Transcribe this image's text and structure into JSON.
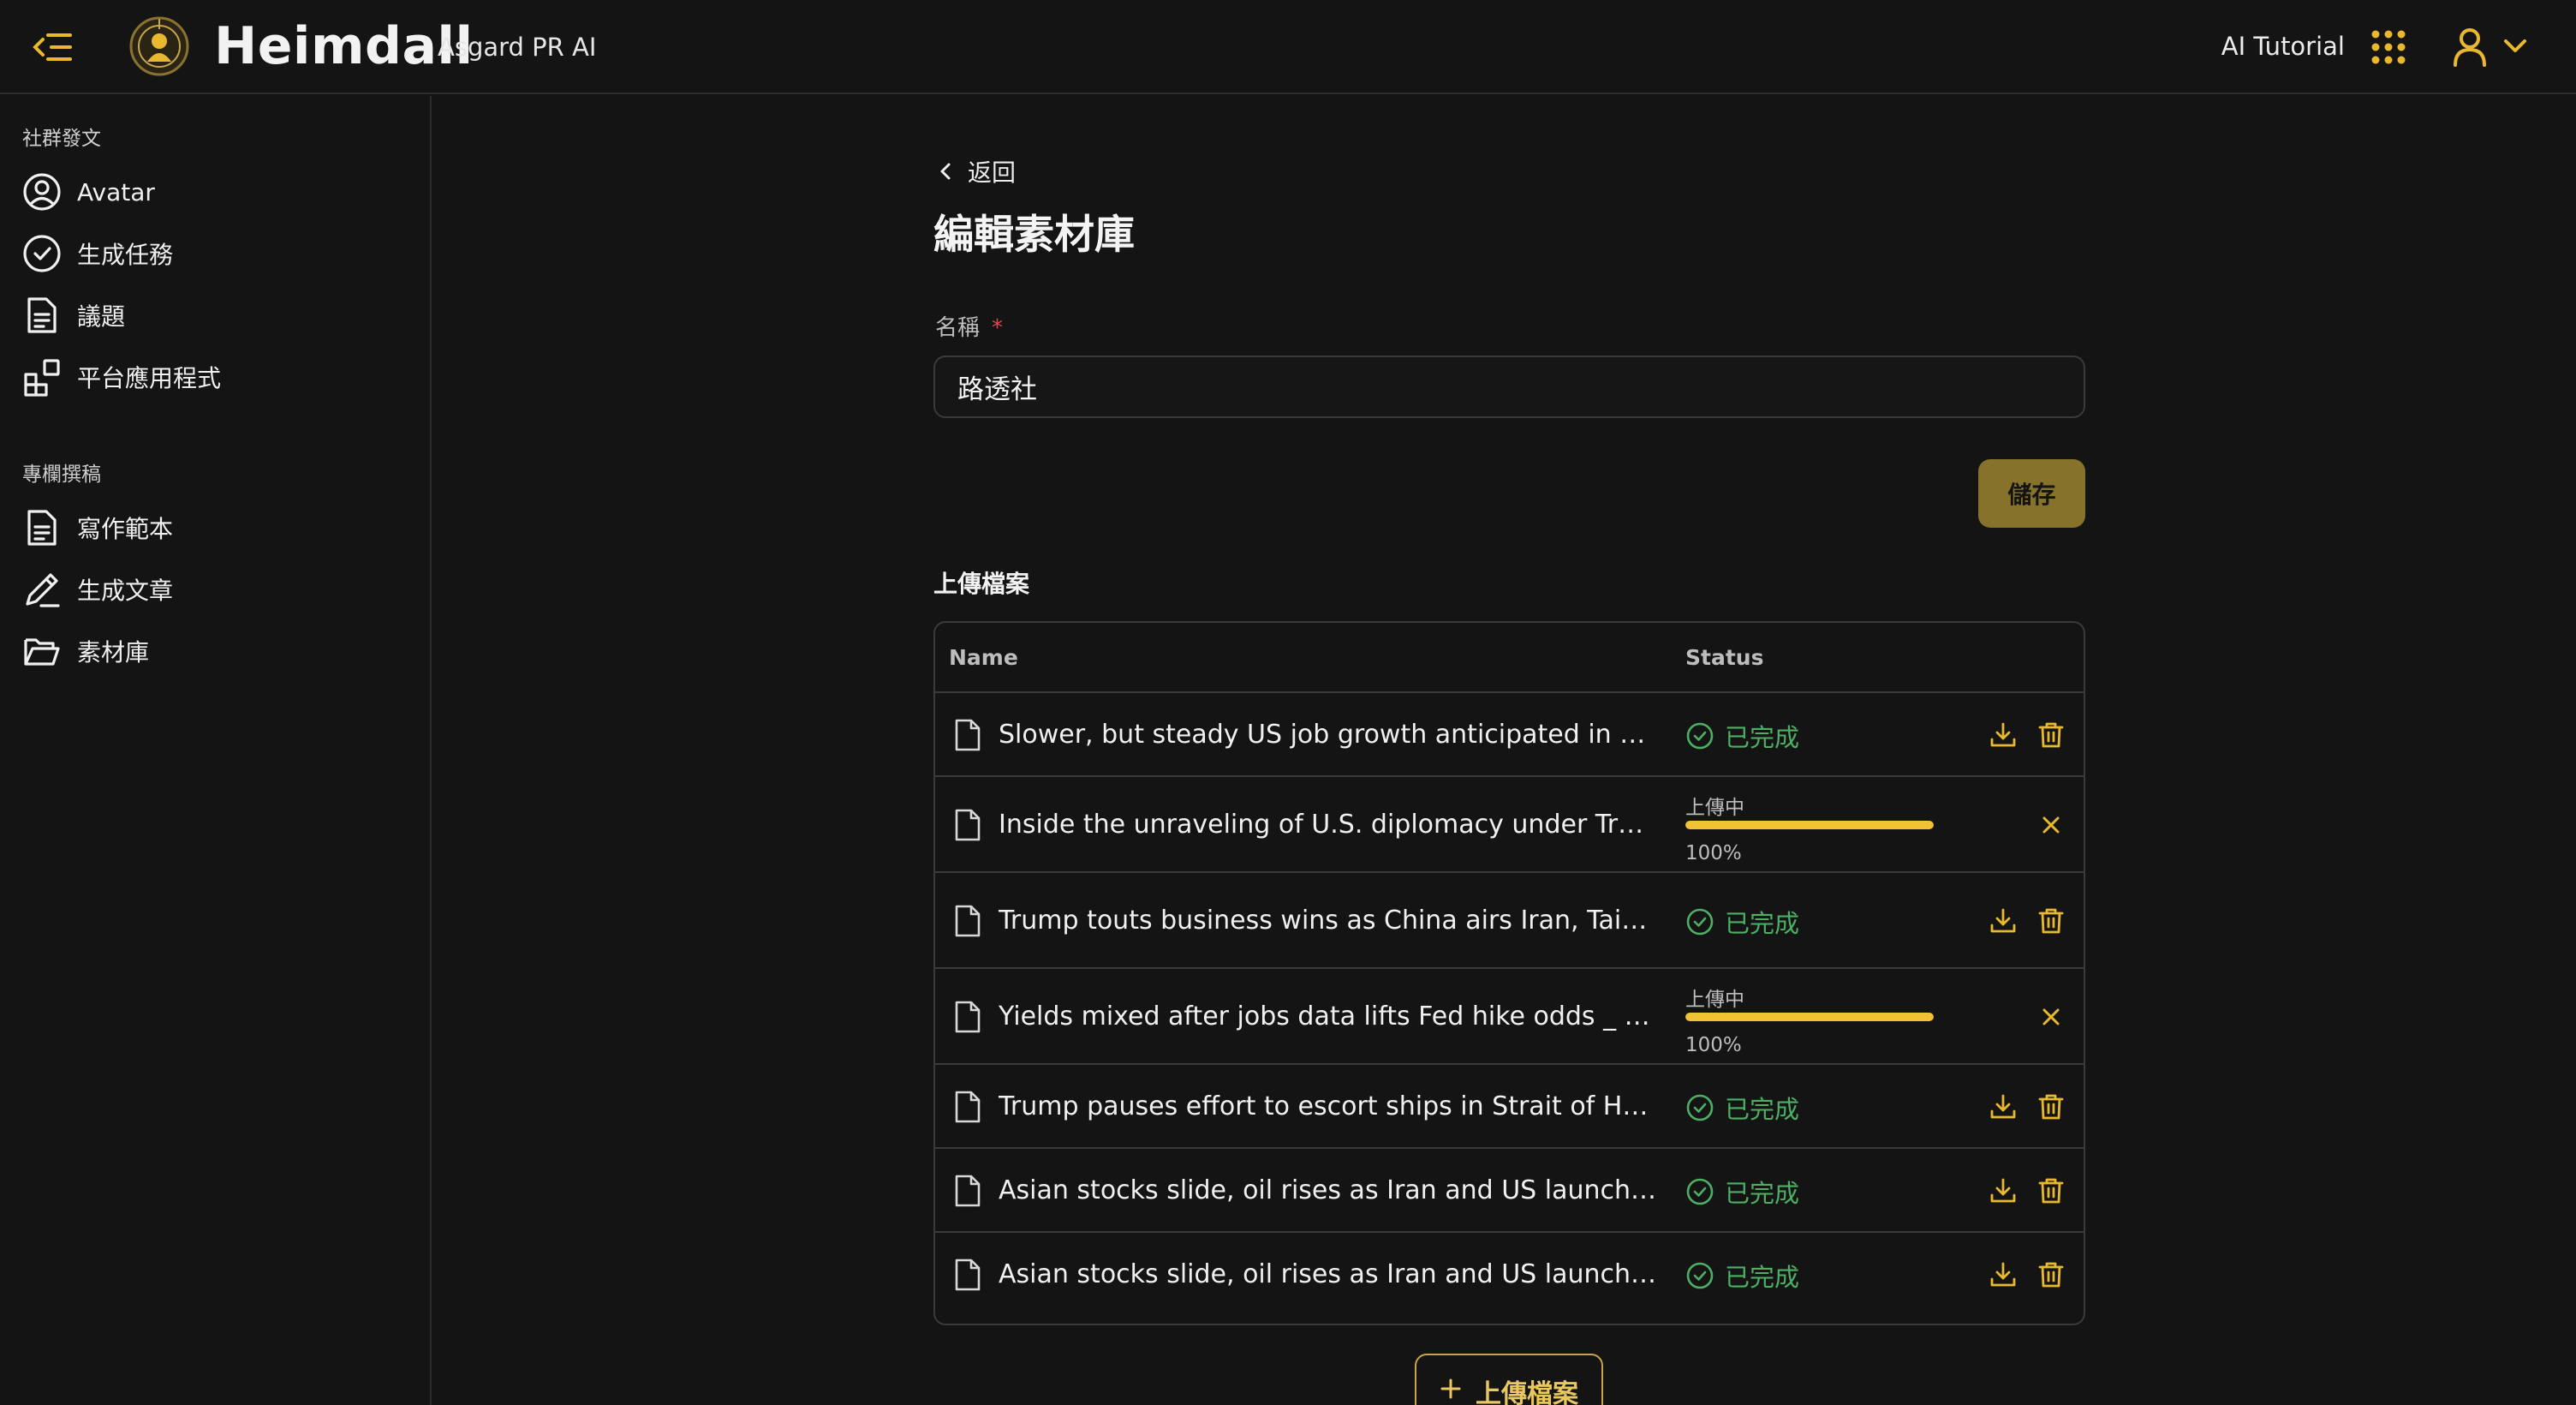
{
  "header": {
    "app_title": "Heimdall",
    "app_subtitle": "Asgard PR AI",
    "tutorial_label": "AI Tutorial",
    "icons": {
      "menu": "menu-collapse-icon",
      "logo": "heimdall-logo",
      "apps": "apps-grid-icon",
      "user": "user-icon",
      "chevron": "chevron-down-icon"
    }
  },
  "sidebar": {
    "sections": [
      {
        "title": "社群發文",
        "items": [
          {
            "label": "Avatar",
            "icon": "user-circle-icon"
          },
          {
            "label": "生成任務",
            "icon": "check-circle-icon"
          },
          {
            "label": "議題",
            "icon": "document-icon"
          },
          {
            "label": "平台應用程式",
            "icon": "apps-add-icon"
          }
        ]
      },
      {
        "title": "專欄撰稿",
        "items": [
          {
            "label": "寫作範本",
            "icon": "document-icon"
          },
          {
            "label": "生成文章",
            "icon": "pen-icon"
          },
          {
            "label": "素材庫",
            "icon": "folder-open-icon"
          }
        ]
      }
    ]
  },
  "main": {
    "back_label": "返回",
    "page_title": "編輯素材庫",
    "name_field": {
      "label": "名稱",
      "required_mark": "*",
      "value": "路透社"
    },
    "save_label": "儲存",
    "upload_section_title": "上傳檔案",
    "table": {
      "columns": [
        "Name",
        "Status"
      ],
      "rows": [
        {
          "name": "Slower, but steady US job growth anticipated in Ma...",
          "status": "已完成"
        },
        {
          "name": "Inside the unraveling of U.S. diplomacy under Trump...",
          "status": "上傳中",
          "progress": "100%"
        },
        {
          "name": "Trump touts business wins as China airs Iran, Taiwan...",
          "status": "已完成"
        },
        {
          "name": "Yields mixed after jobs data lifts Fed hike odds _ Re...",
          "status": "上傳中",
          "progress": "100%"
        },
        {
          "name": "Trump pauses effort to escort ships in Strait of Hor...",
          "status": "已完成"
        },
        {
          "name": "Asian stocks slide, oil rises as Iran and US launch str...",
          "status": "已完成"
        },
        {
          "name": "Asian stocks slide, oil rises as Iran and US launch str...",
          "status": "已完成"
        }
      ]
    },
    "upload_button_label": "上傳檔案"
  },
  "colors": {
    "background": "#141414",
    "accent": "#e8b92f",
    "success": "#4caf64",
    "save_button": "#86722a",
    "required": "#e04848"
  }
}
